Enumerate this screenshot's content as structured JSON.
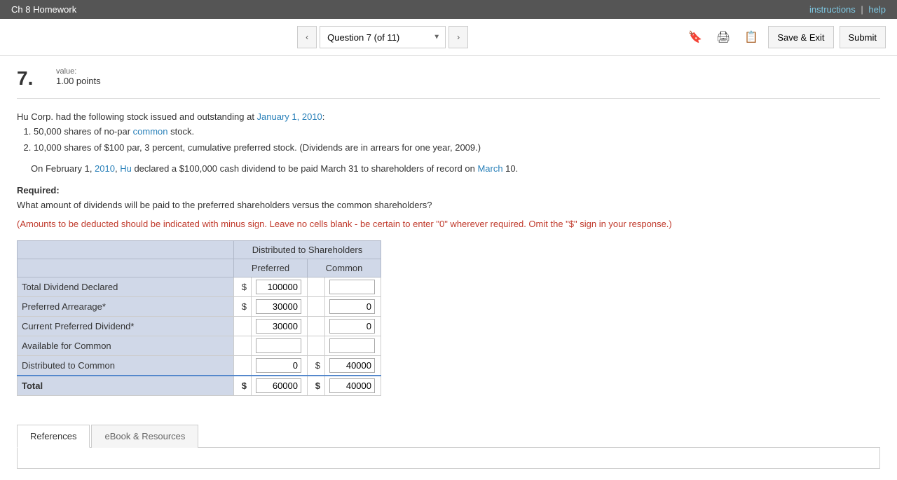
{
  "topBar": {
    "title": "Ch 8 Homework",
    "links": {
      "instructions": "instructions",
      "separator": "|",
      "help": "help"
    }
  },
  "nav": {
    "prevLabel": "‹",
    "nextLabel": "›",
    "questionSelector": "Question 7 (of 11)",
    "saveExitLabel": "Save & Exit",
    "submitLabel": "Submit"
  },
  "question": {
    "number": "7.",
    "valueLabel": "value:",
    "points": "1.00 points",
    "body": {
      "intro": "Hu Corp. had the following stock issued and outstanding at January 1, 2010:",
      "items": [
        "50,000 shares of no-par common stock.",
        "10,000 shares of $100 par, 3 percent, cumulative preferred stock. (Dividends are in arrears for one year, 2009.)"
      ],
      "paragraph": "On February 1, 2010, Hu declared a $100,000 cash dividend to be paid March 31 to shareholders of record on March 10.",
      "required": "Required:",
      "question": "What amount of dividends will be paid to the preferred shareholders versus the common shareholders?",
      "warning": "(Amounts to be deducted should be indicated with minus sign. Leave no cells blank - be certain to enter \"0\" wherever required. Omit the \"$\" sign in your response.)"
    }
  },
  "table": {
    "header": "Distributed to Shareholders",
    "colPreferred": "Preferred",
    "colCommon": "Common",
    "rows": [
      {
        "label": "Total Dividend Declared",
        "prefDollar": "$",
        "prefValue": "100000",
        "commDollar": "",
        "commValue": ""
      },
      {
        "label": "Preferred Arrearage*",
        "prefDollar": "$",
        "prefValue": "30000",
        "commDollar": "",
        "commValue": "0"
      },
      {
        "label": "Current Preferred Dividend*",
        "prefDollar": "",
        "prefValue": "30000",
        "commDollar": "",
        "commValue": "0"
      },
      {
        "label": "Available for Common",
        "prefDollar": "",
        "prefValue": "",
        "commDollar": "",
        "commValue": ""
      },
      {
        "label": "Distributed to Common",
        "prefDollar": "",
        "prefValue": "0",
        "commDollar": "$",
        "commValue": "40000"
      },
      {
        "label": "Total",
        "prefDollar": "$",
        "prefValue": "60000",
        "commDollar": "$",
        "commValue": "40000",
        "isTotal": true
      }
    ]
  },
  "tabs": [
    {
      "label": "References",
      "active": true
    },
    {
      "label": "eBook & Resources",
      "active": false
    }
  ]
}
